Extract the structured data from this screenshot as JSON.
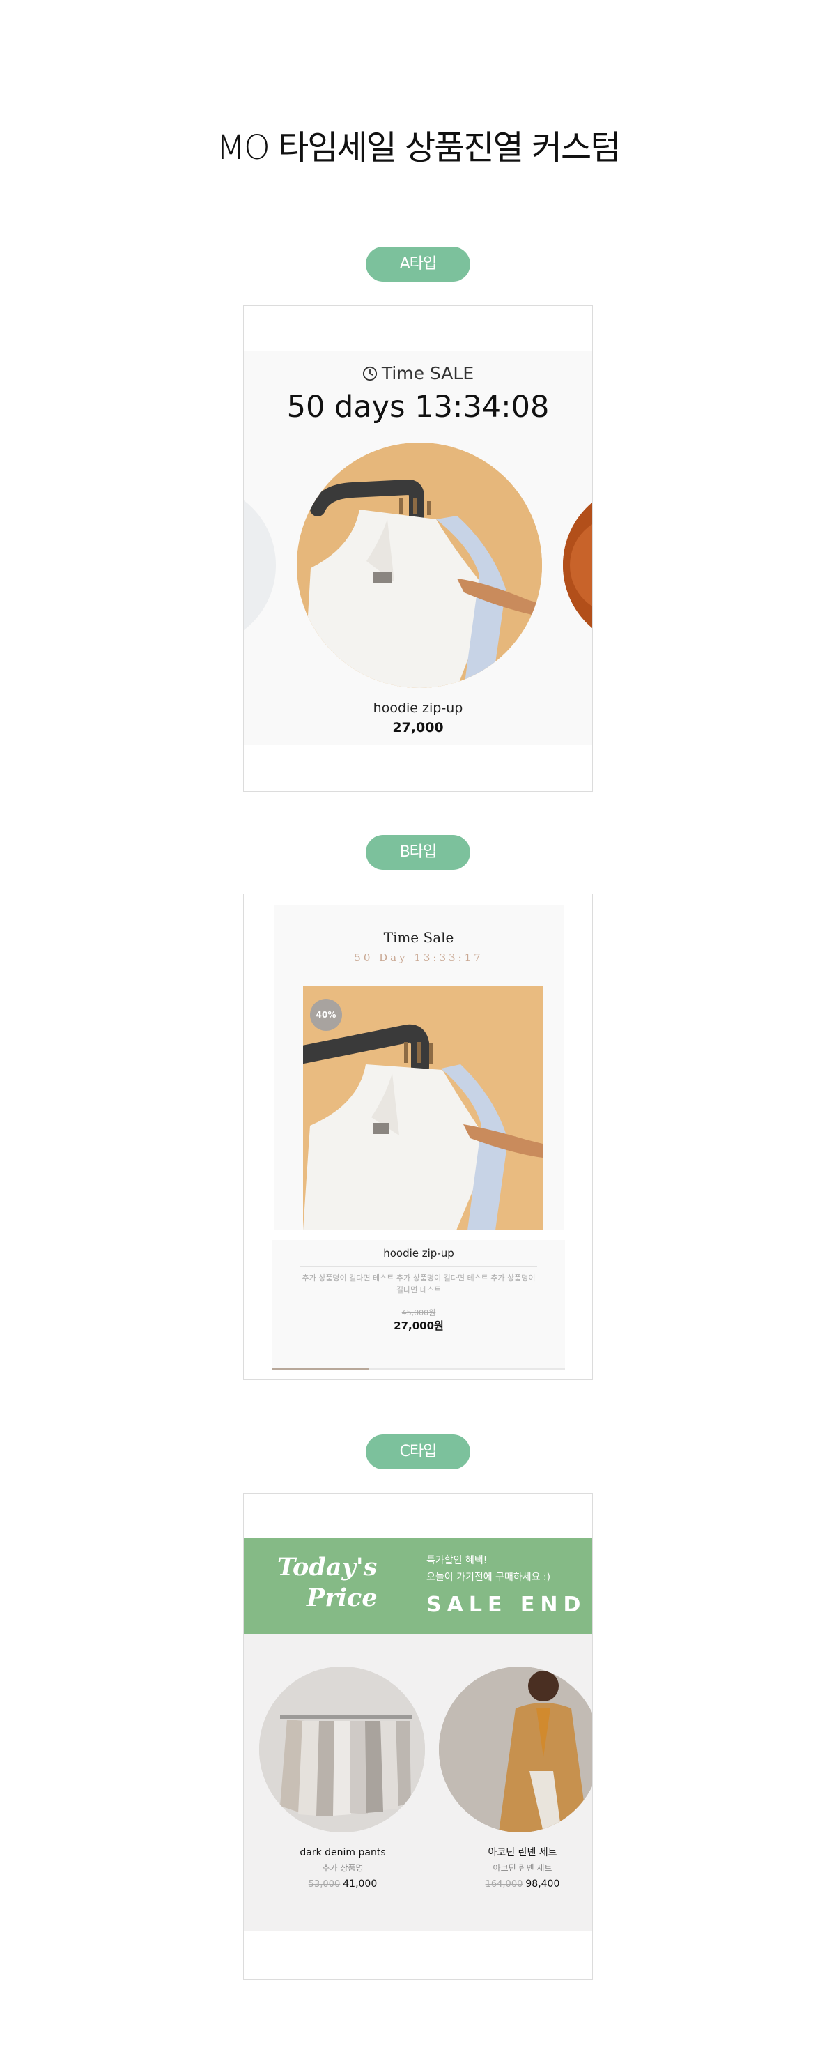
{
  "page": {
    "title": "MO 타임세일 상품진열 커스텀"
  },
  "sections": [
    {
      "badge": "A타입"
    },
    {
      "badge": "B타입"
    },
    {
      "badge": "C타입"
    }
  ],
  "type_a": {
    "label": "Time SALE",
    "timer": "50 days 13:34:08",
    "product": {
      "name": "hoodie zip-up",
      "price": "27,000"
    },
    "icons": [
      "clock-icon"
    ]
  },
  "type_b": {
    "label": "Time Sale",
    "timer": "50 Day 13:33:17",
    "discount_badge": "40%",
    "product": {
      "name": "hoodie zip-up",
      "description": "추가 상품명이 길다면 테스트 추가 상품명이 길다면 테스트 추가 상품명이 길다면 테스트",
      "original_price": "45,000원",
      "sale_price": "27,000원"
    },
    "progress": 0.33
  },
  "type_c": {
    "banner": {
      "title_line1": "Today's",
      "title_line2": "Price",
      "copy_line1": "특가할인 혜택!",
      "copy_line2": "오늘이 가기전에 구매하세요 :)",
      "end_text": "SALE END",
      "color": "#85ba86"
    },
    "products": [
      {
        "name": "dark denim pants",
        "subtitle": "추가 상품명",
        "original_price": "53,000",
        "sale_price": "41,000"
      },
      {
        "name": "아코딘 린넨 세트",
        "subtitle": "아코딘 린넨 세트",
        "original_price": "164,000",
        "sale_price": "98,400"
      }
    ]
  },
  "colors": {
    "badge": "#7cc19c",
    "accent_timer": "#c9a893"
  }
}
